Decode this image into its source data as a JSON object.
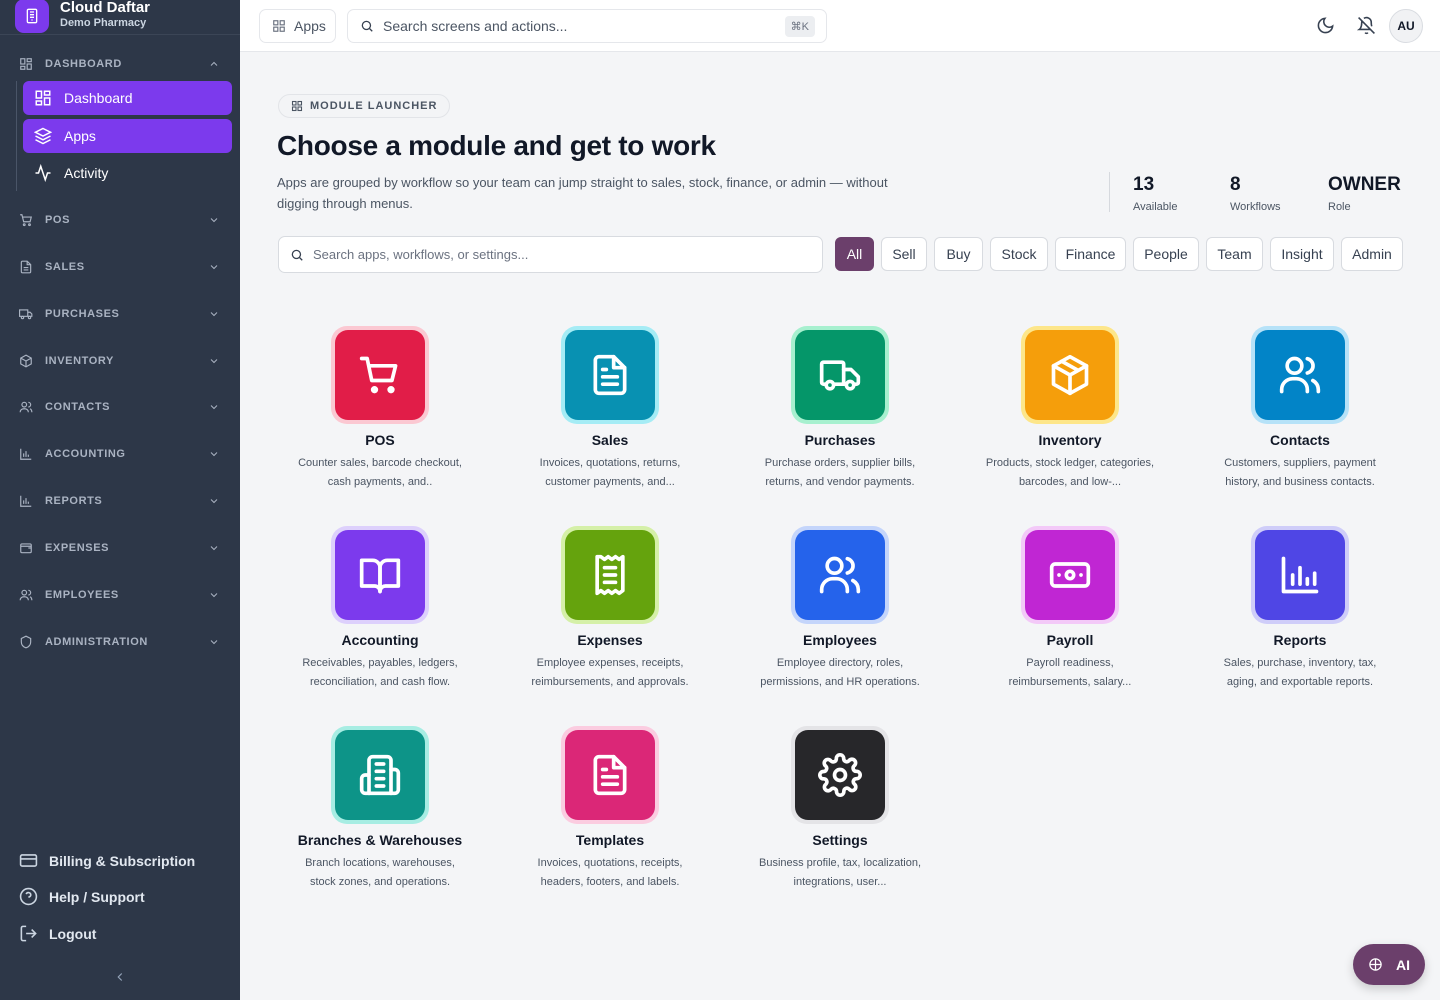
{
  "brand": {
    "title": "Cloud Daftar",
    "subtitle": "Demo Pharmacy"
  },
  "sidebar": {
    "dashboard_section": "DASHBOARD",
    "items": [
      {
        "label": "Dashboard",
        "icon": "dashboard-icon"
      },
      {
        "label": "Apps",
        "icon": "layers-icon"
      },
      {
        "label": "Activity",
        "icon": "activity-icon"
      }
    ],
    "sections": [
      {
        "label": "POS",
        "icon": "cart-icon"
      },
      {
        "label": "SALES",
        "icon": "document-icon"
      },
      {
        "label": "PURCHASES",
        "icon": "truck-icon"
      },
      {
        "label": "INVENTORY",
        "icon": "package-icon"
      },
      {
        "label": "CONTACTS",
        "icon": "users-icon"
      },
      {
        "label": "ACCOUNTING",
        "icon": "chart-icon"
      },
      {
        "label": "REPORTS",
        "icon": "chart-icon"
      },
      {
        "label": "EXPENSES",
        "icon": "wallet-icon"
      },
      {
        "label": "EMPLOYEES",
        "icon": "users-icon"
      },
      {
        "label": "ADMINISTRATION",
        "icon": "shield-icon"
      }
    ],
    "footer": {
      "billing": "Billing & Subscription",
      "help": "Help / Support",
      "logout": "Logout"
    }
  },
  "topbar": {
    "apps_label": "Apps",
    "search_placeholder": "Search screens and actions...",
    "shortcut": "⌘K",
    "avatar": "AU"
  },
  "main": {
    "badge": "MODULE LAUNCHER",
    "title": "Choose a module and get to work",
    "description": "Apps are grouped by workflow so your team can jump straight to sales, stock, finance, or admin — without digging through menus.",
    "stats": [
      {
        "value": "13",
        "label": "Available"
      },
      {
        "value": "8",
        "label": "Workflows"
      },
      {
        "value": "OWNER",
        "label": "Role"
      }
    ],
    "search_placeholder": "Search apps, workflows, or settings...",
    "filters": [
      "All",
      "Sell",
      "Buy",
      "Stock",
      "Finance",
      "People",
      "Team",
      "Insight",
      "Admin"
    ],
    "active_filter": "All"
  },
  "modules": [
    {
      "name": "POS",
      "desc": "Counter sales, barcode checkout, cash payments, and..",
      "color": "#e11d48",
      "ring": "#fbc8d2",
      "icon": "cart-icon"
    },
    {
      "name": "Sales",
      "desc": "Invoices, quotations, returns, customer payments, and...",
      "color": "#0891b2",
      "ring": "#a5ecf5",
      "icon": "document-icon"
    },
    {
      "name": "Purchases",
      "desc": "Purchase orders, supplier bills, returns, and vendor payments.",
      "color": "#059669",
      "ring": "#a7f0cf",
      "icon": "truck-icon"
    },
    {
      "name": "Inventory",
      "desc": "Products, stock ledger, categories, barcodes, and low-...",
      "color": "#f59e0b",
      "ring": "#fde68a",
      "icon": "package-icon"
    },
    {
      "name": "Contacts",
      "desc": "Customers, suppliers, payment history, and business contacts.",
      "color": "#0284c7",
      "ring": "#b6e2f8",
      "icon": "users-icon"
    },
    {
      "name": "Accounting",
      "desc": "Receivables, payables, ledgers, reconciliation, and cash flow.",
      "color": "#7c3aed",
      "ring": "#ddd0fc",
      "icon": "book-icon"
    },
    {
      "name": "Expenses",
      "desc": "Employee expenses, receipts, reimbursements, and approvals.",
      "color": "#65a30d",
      "ring": "#d5f0a8",
      "icon": "receipt-icon"
    },
    {
      "name": "Employees",
      "desc": "Employee directory, roles, permissions, and HR operations.",
      "color": "#2563eb",
      "ring": "#c4d5fb",
      "icon": "users-icon"
    },
    {
      "name": "Payroll",
      "desc": "Payroll readiness, reimbursements, salary...",
      "color": "#c026d3",
      "ring": "#f3c9f8",
      "icon": "banknote-icon"
    },
    {
      "name": "Reports",
      "desc": "Sales, purchase, inventory, tax, aging, and exportable reports.",
      "color": "#4f46e5",
      "ring": "#cfcdf9",
      "icon": "chart-icon"
    },
    {
      "name": "Branches & Warehouses",
      "desc": "Branch locations, warehouses, stock zones, and operations.",
      "color": "#0d9488",
      "ring": "#a7ede3",
      "icon": "building-icon"
    },
    {
      "name": "Templates",
      "desc": "Invoices, quotations, receipts, headers, footers, and labels.",
      "color": "#db2777",
      "ring": "#fbcce0",
      "icon": "document-icon"
    },
    {
      "name": "Settings",
      "desc": "Business profile, tax, localization, integrations, user...",
      "color": "#27272a",
      "ring": "#e4e4e7",
      "icon": "gear-icon"
    }
  ],
  "ai_button": "AI"
}
